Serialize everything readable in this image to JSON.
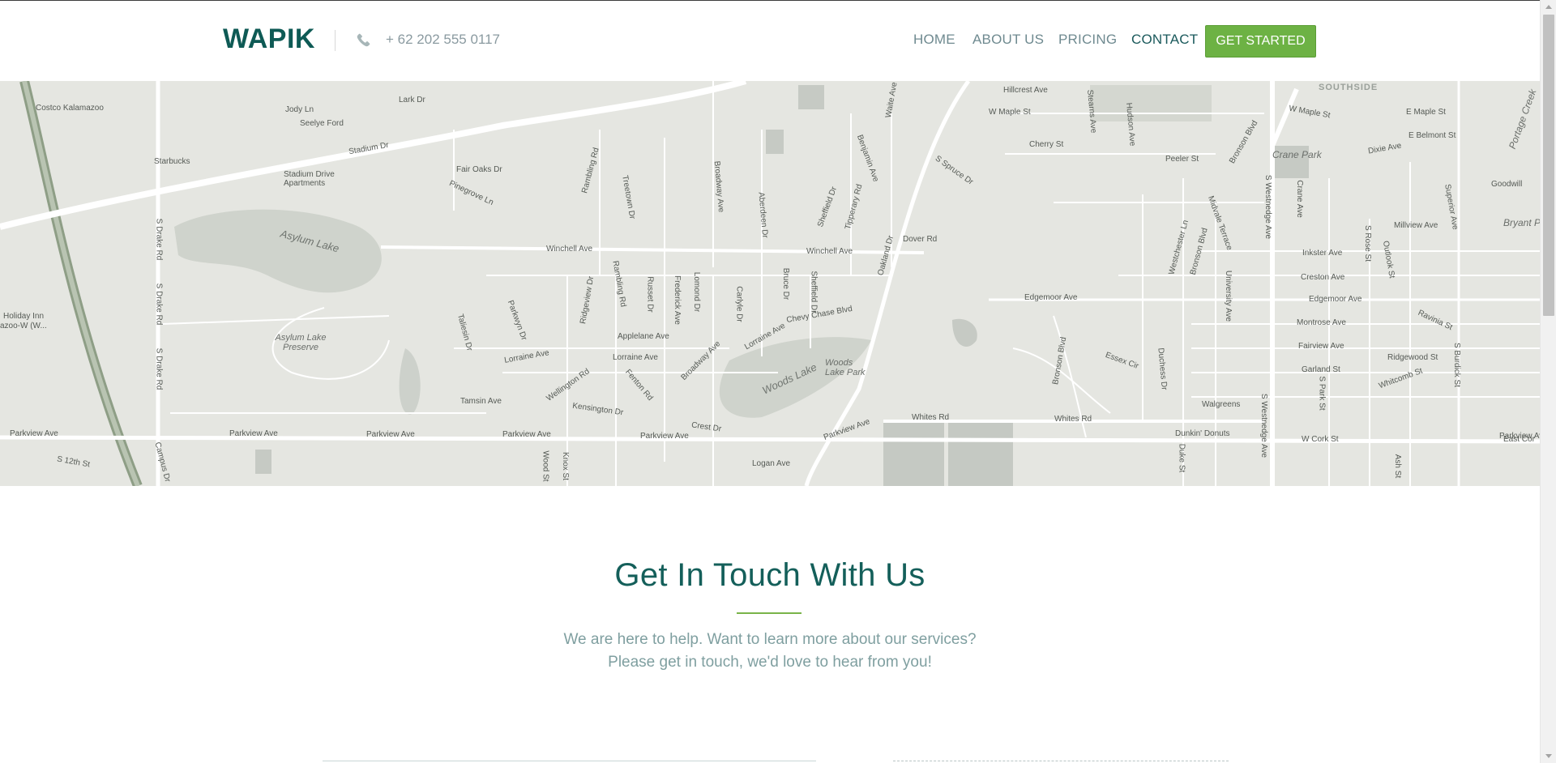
{
  "header": {
    "logo": "WAPIK",
    "phone": "+ 62 202 555 0117",
    "nav": [
      {
        "label": "HOME"
      },
      {
        "label": "ABOUT US"
      },
      {
        "label": "PRICING"
      },
      {
        "label": "CONTACT"
      }
    ],
    "cta_label": "GET STARTED",
    "icons": {
      "phone": "phone-icon"
    }
  },
  "map": {
    "labels": [
      "Costco Kalamazoo",
      "Jody Ln",
      "Seelye Ford",
      "Lark Dr",
      "Stadium Dr",
      "Starbucks",
      "Stadium Drive Apartments",
      "Fair Oaks Dr",
      "Pinegrove Ln",
      "Rambling Rd",
      "Treetown Dr",
      "Broadway Ave",
      "Aberdeen Dr",
      "Sheffield Dr",
      "Tipperary Rd",
      "Benjamin Ave",
      "S Spruce Dr",
      "Waite Ave",
      "Hillcrest Ave",
      "W Maple St",
      "Stearns Ave",
      "Hudson Ave",
      "Cherry St",
      "Peeler St",
      "Bronson Blvd",
      "SOUTHSIDE",
      "W Maple St",
      "E Maple St",
      "E Belmont St",
      "Dixie Ave",
      "Portage Creek",
      "Crane Park",
      "Goodwill",
      "Bryant Por",
      "Asylum Lake",
      "Winchell Ave",
      "Winchell Ave",
      "Dover Rd",
      "Oakland Dr",
      "S Drake Rd",
      "S Drake Rd",
      "S Drake Rd",
      "Holiday Inn",
      "azoo-W (W...",
      "Asylum Lake Preserve",
      "Taliesin Dr",
      "Parkwyn Dr",
      "Ridgeview Dr",
      "Rambling Rd",
      "Russet Dr",
      "Frederick Ave",
      "Lomond Dr",
      "Carlyle Dr",
      "Bruce Dr",
      "Sheffield Dr",
      "Edgemoor Ave",
      "Chevy Chase Blvd",
      "Applelane Ave",
      "Lorraine Ave",
      "Lorraine Ave",
      "Lorraine Ave",
      "Westchester Ln",
      "Bronson Blvd",
      "Midvale Terrace",
      "University Ave",
      "S Westnedge Ave",
      "Crane Ave",
      "S Rose St",
      "Outlook St",
      "Superior Ave",
      "Millview Ave",
      "Inkster Ave",
      "Creston Ave",
      "Edgemoor Ave",
      "Montrose Ave",
      "Fairview Ave",
      "Garland St",
      "Ravinia St",
      "Ridgewood St",
      "Whitcomb St",
      "S Park St",
      "Woods Lake",
      "Woods Lake Park",
      "Broadway Ave",
      "Wellington Rd",
      "Fenton Rd",
      "Kensington Dr",
      "Tamsin Ave",
      "Bronson Blvd",
      "Essex Cir",
      "Duchess Dr",
      "Walgreens",
      "Whites Rd",
      "Whites Rd",
      "Crest Dr",
      "Parkview Ave",
      "Parkview Ave",
      "Parkview Ave",
      "Parkview Ave",
      "Parkview Ave",
      "Parkview Ave",
      "Parkview Ave",
      "Dunkin' Donuts",
      "W Cork St",
      "East Cor",
      "S 12th St",
      "Campus Dr",
      "Logan Ave",
      "Wood St",
      "Knox St",
      "Duke St",
      "Ash St",
      "S Burdick St",
      "S Westnedge Ave"
    ]
  },
  "contact": {
    "title": "Get In Touch With Us",
    "subtitle_line1": "We are here to help. Want to learn more about our services?",
    "subtitle_line2": "Please get in touch, we'd love to hear from you!"
  },
  "colors": {
    "brand": "#0e5a55",
    "accent": "#6db244",
    "nav_text": "#6f8a90",
    "subtitle": "#7f9fa0",
    "map_bg": "#e5e6e1"
  }
}
